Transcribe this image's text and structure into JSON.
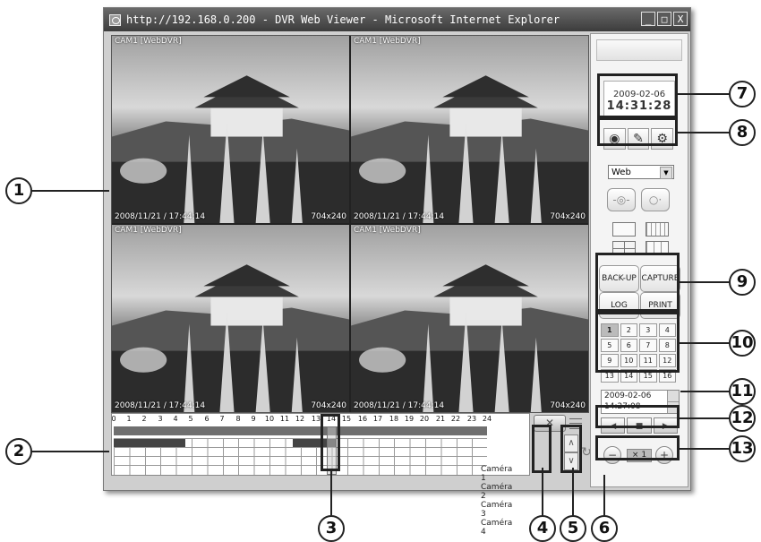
{
  "window": {
    "title": "http://192.168.0.200 - DVR Web Viewer - Microsoft Internet Explorer",
    "min_label": "_",
    "max_label": "□",
    "close_label": "X"
  },
  "cameras": [
    {
      "label": "CAM1 [WebDVR]",
      "timestamp": "2008/11/21 / 17:44:14",
      "resolution": "704x240"
    },
    {
      "label": "CAM1 [WebDVR]",
      "timestamp": "2008/11/21 / 17:44:14",
      "resolution": "704x240"
    },
    {
      "label": "CAM1 [WebDVR]",
      "timestamp": "2008/11/21 / 17:44:14",
      "resolution": "704x240"
    },
    {
      "label": "CAM1 [WebDVR]",
      "timestamp": "2008/11/21 / 17:44:14",
      "resolution": "704x240"
    }
  ],
  "timeline": {
    "hours": [
      "0",
      "1",
      "2",
      "3",
      "4",
      "5",
      "6",
      "7",
      "8",
      "9",
      "10",
      "11",
      "12",
      "13",
      "14",
      "15",
      "16",
      "17",
      "18",
      "19",
      "20",
      "21",
      "22",
      "23",
      "24"
    ],
    "camera_rows": [
      "Caméra 1",
      "Caméra 2",
      "Caméra 3",
      "Caméra 4"
    ],
    "mute_icon": "mute-icon",
    "scroll_up": "∧",
    "scroll_down": "∨"
  },
  "panel": {
    "date": "2009-02-06",
    "time": "14:31:28",
    "mode_select": "Web",
    "mode_arrow": "▼",
    "buttons": {
      "backup": "BACK-UP",
      "capture": "CAPTURE",
      "log": "LOG",
      "print": "PRINT"
    },
    "numbers": [
      "1",
      "2",
      "3",
      "4",
      "5",
      "6",
      "7",
      "8",
      "9",
      "10",
      "11",
      "12",
      "13",
      "14",
      "15",
      "16"
    ],
    "search_date": "2009-02-06",
    "search_time": "14:27:08",
    "play_prev": "◀",
    "play_stop": "■",
    "play_next": "▶",
    "speed_minus": "−",
    "speed_value": "× 1",
    "speed_plus": "+"
  },
  "callouts": [
    "1",
    "2",
    "3",
    "4",
    "5",
    "6",
    "7",
    "8",
    "9",
    "10",
    "11",
    "12",
    "13"
  ]
}
